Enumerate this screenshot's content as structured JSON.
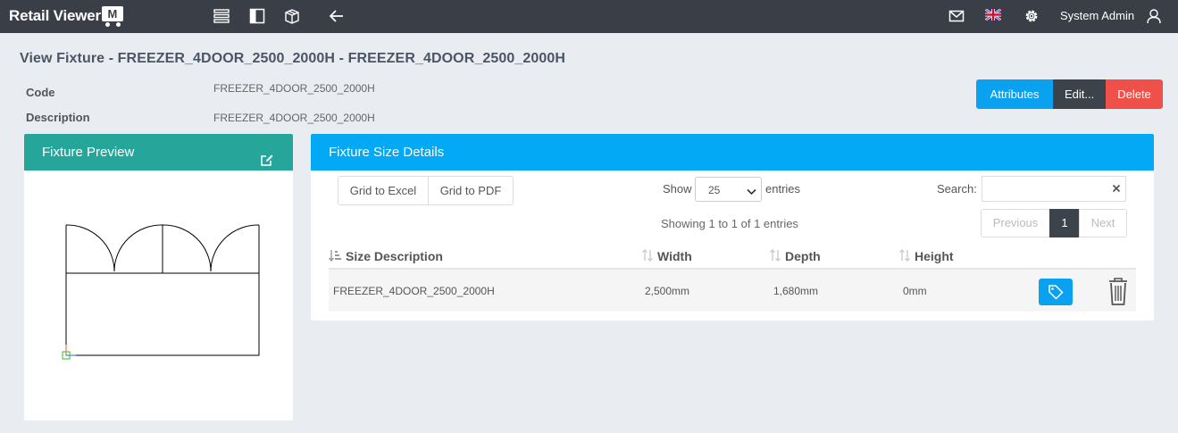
{
  "header": {
    "logo_text": "Retail Viewer",
    "logo_mark": "M",
    "user_name": "System Admin",
    "icons": [
      "list-icon",
      "sidebar-toggle-icon",
      "box-icon",
      "back-arrow-icon",
      "mail-icon",
      "uk-flag-icon",
      "gear-icon",
      "user-icon"
    ]
  },
  "page": {
    "title": "View Fixture - FREEZER_4DOOR_2500_2000H - FREEZER_4DOOR_2500_2000H",
    "code_label": "Code",
    "code_value": "FREEZER_4DOOR_2500_2000H",
    "description_label": "Description",
    "description_value": "FREEZER_4DOOR_2500_2000H"
  },
  "actions": {
    "attributes_label": "Attributes",
    "edit_label": "Edit...",
    "delete_label": "Delete"
  },
  "preview_panel": {
    "title": "Fixture Preview",
    "header_color": "#26a69a"
  },
  "size_panel": {
    "title": "Fixture Size Details",
    "header_color": "#03a9f4",
    "grid_excel_label": "Grid to Excel",
    "grid_pdf_label": "Grid to PDF",
    "show_label": "Show",
    "entries_label": "entries",
    "page_size": "25",
    "search_label": "Search:",
    "search_value": "",
    "info_text": "Showing 1 to 1 of 1 entries",
    "pagination": {
      "previous_label": "Previous",
      "current_page": "1",
      "next_label": "Next"
    },
    "columns": [
      "Size Description",
      "Width",
      "Depth",
      "Height"
    ],
    "rows": [
      {
        "size_description": "FREEZER_4DOOR_2500_2000H",
        "width": "2,500mm",
        "depth": "1,680mm",
        "height": "0mm"
      }
    ]
  }
}
